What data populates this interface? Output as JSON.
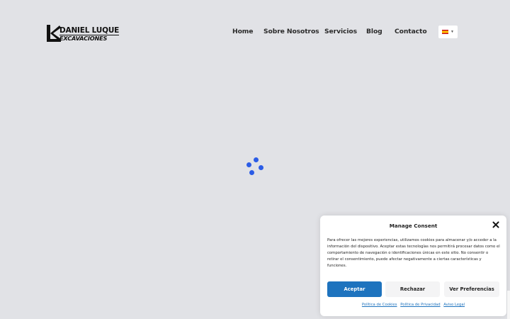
{
  "header": {
    "logo": {
      "line1": "DANIEL LUQUE",
      "line2": "EXCAVACIONES"
    },
    "nav": [
      {
        "label": "Home"
      },
      {
        "label": "Sobre Nosotros"
      },
      {
        "label": "Servicios"
      },
      {
        "label": "Blog"
      },
      {
        "label": "Contacto"
      }
    ],
    "language": {
      "flag_icon": "spain-flag-icon",
      "chevron_icon": "chevron-down-icon"
    }
  },
  "loader": {
    "icon": "loading-spinner-icon",
    "color": "#2b5ce6"
  },
  "consent": {
    "title": "Manage Consent",
    "close_icon": "close-icon",
    "text": "Para ofrecer las mejores experiencias, utilizamos cookies para almacenar y/o acceder a la información del dispositivo. Aceptar estas tecnologías nos permitirá procesar datos como el comportamiento de navegación o identificaciones únicas en este sitio. No consentir o retirar el consentimiento, puede afectar negativamente a ciertas características y funciones.",
    "buttons": {
      "accept": "Aceptar",
      "deny": "Rechazar",
      "preferences": "Ver Preferencias"
    },
    "links": {
      "cookies": "Política de Cookies",
      "privacy": "Política de Privacidad",
      "legal": "Aviso Legal"
    },
    "accent_color": "#1e73be"
  },
  "colors": {
    "background": "#e1e2e6",
    "nav_text": "#2b2b2b"
  }
}
